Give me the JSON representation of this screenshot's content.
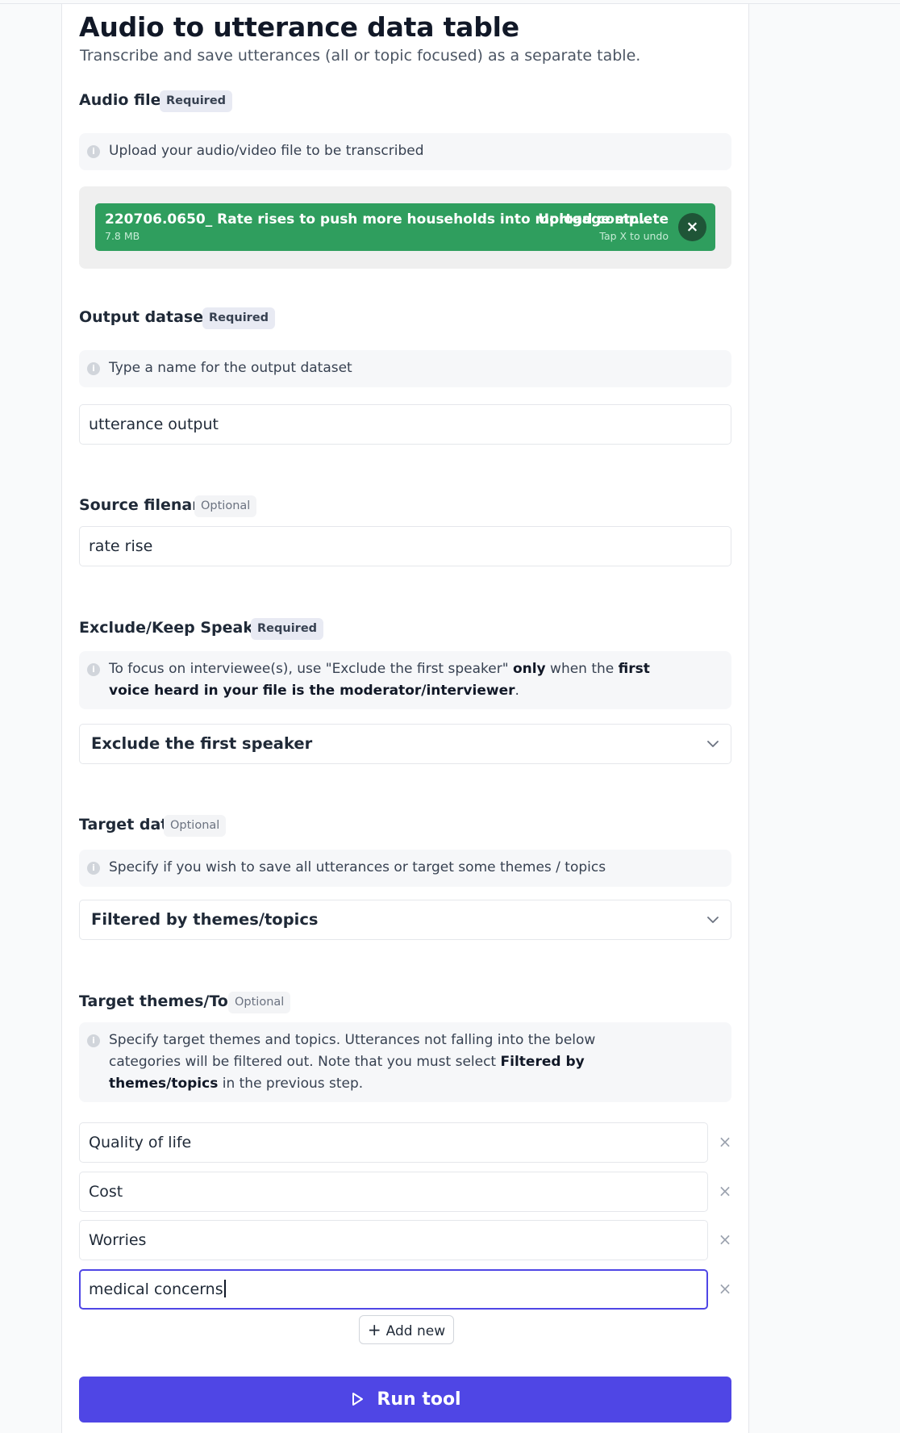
{
  "page": {
    "title": "Audio to utterance data table",
    "subtitle": "Transcribe and save utterances (all or topic focused) as a separate table."
  },
  "audio_file": {
    "label": "Audio file",
    "badge": "Required",
    "hint": "Upload your audio/video file to be transcribed",
    "upload": {
      "file_name": "220706.0650_ Rate rises to push more households into mortgage str...",
      "file_size": "7.8 MB",
      "status": "Upload complete",
      "undo_hint": "Tap X to undo",
      "close_icon": "×"
    }
  },
  "output_dataset": {
    "label": "Output dataset",
    "badge": "Required",
    "hint": "Type a name for the output dataset",
    "value": "utterance output"
  },
  "source_filename": {
    "label": "Source filename",
    "badge": "Optional",
    "value": "rate rise"
  },
  "speaker": {
    "label": "Exclude/Keep Speaker",
    "badge": "Required",
    "hint_line1_pre": "To focus on interviewee(s), use \"Exclude the first speaker\" ",
    "hint_line1_b1": "only",
    "hint_line1_mid": " when the ",
    "hint_line1_b2": "first",
    "hint_line2_b": "voice heard in your file is the moderator/interviewer",
    "hint_line2_post": ".",
    "selected": "Exclude the first speaker"
  },
  "target_data": {
    "label": "Target data",
    "badge": "Optional",
    "hint": "Specify if you wish to save all utterances or target some themes / topics",
    "selected": "Filtered by themes/topics"
  },
  "target_topics": {
    "label": "Target themes/Topics",
    "badge": "Optional",
    "hint_line1": "Specify target themes and topics. Utterances not falling into the below",
    "hint_line2_pre": "categories will be filtered out. Note that you must select ",
    "hint_line2_b": "Filtered by",
    "hint_line3_b": "themes/topics",
    "hint_line3_post": " in the previous step.",
    "items": [
      "Quality of life",
      "Cost",
      "Worries",
      "medical concerns"
    ],
    "remove_icon": "×",
    "add_label": "Add new",
    "add_icon": "+"
  },
  "actions": {
    "run_label": "Run tool"
  },
  "colors": {
    "accent": "#4f46e5",
    "upload_success": "#2f9e5e"
  }
}
